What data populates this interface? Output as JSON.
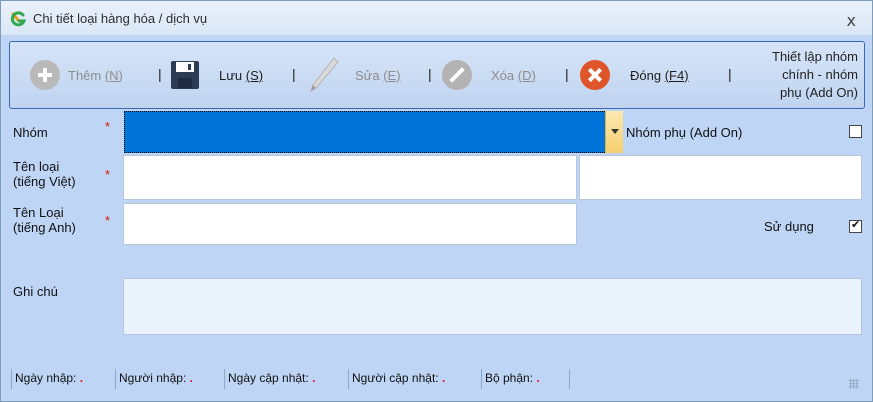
{
  "window": {
    "title": "Chi tiết loại hàng hóa / dịch vụ",
    "close_symbol": "x"
  },
  "toolbar": {
    "add": {
      "text": "Thêm ",
      "key": "(N)"
    },
    "save": {
      "text": "Lưu ",
      "key": "(S)"
    },
    "edit": {
      "text": "Sửa ",
      "key": "(E)"
    },
    "delete": {
      "text": "Xóa ",
      "key": "(D)"
    },
    "close": {
      "text": "Đóng ",
      "key": "(F4)"
    },
    "separator": "|",
    "setup_line1": "Thiết lập nhóm",
    "setup_line2": "chính - nhóm",
    "setup_line3": "phụ (Add On)"
  },
  "form": {
    "group_label": "Nhóm",
    "required_mark": "*",
    "addon_label": "Nhóm phụ (Add On)",
    "addon_checked": false,
    "name_vi_label_1": "Tên loại",
    "name_vi_label_2": "(tiếng Việt)",
    "name_en_label_1": "Tên Loại",
    "name_en_label_2": "(tiếng Anh)",
    "in_use_label": "Sử dụng",
    "in_use_checked": true,
    "note_label": "Ghi chú"
  },
  "status": {
    "created_date": "Ngày nhập:",
    "created_by": "Người nhập:",
    "updated_date": "Ngày cập nhật:",
    "updated_by": "Người cập nhật:",
    "department": "Bộ phận:",
    "value_placeholder": "."
  },
  "colors": {
    "selection_blue": "#0074d9",
    "window_bg": "#bfd5f6",
    "required_red": "#e01010"
  }
}
